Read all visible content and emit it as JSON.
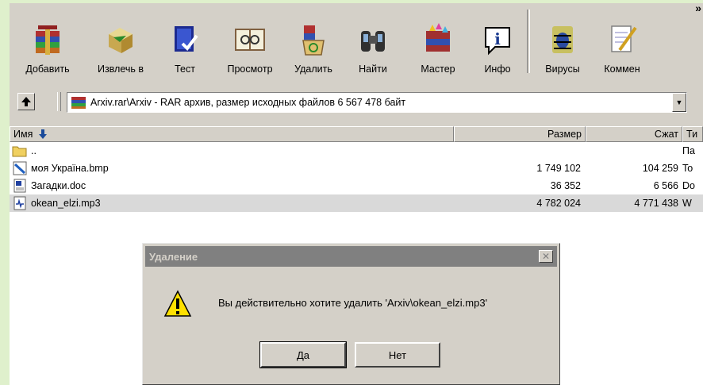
{
  "toolbar": {
    "buttons": [
      {
        "label": "Добавить",
        "icon": "add-archive-icon"
      },
      {
        "label": "Извлечь в",
        "icon": "extract-icon"
      },
      {
        "label": "Тест",
        "icon": "test-icon"
      },
      {
        "label": "Просмотр",
        "icon": "view-icon"
      },
      {
        "label": "Удалить",
        "icon": "delete-icon"
      },
      {
        "label": "Найти",
        "icon": "find-icon"
      },
      {
        "label": "Мастер",
        "icon": "wizard-icon"
      },
      {
        "label": "Инфо",
        "icon": "info-icon"
      },
      {
        "label": "Вирусы",
        "icon": "virus-scan-icon"
      },
      {
        "label": "Коммен",
        "icon": "comment-icon"
      }
    ],
    "overflow": "»"
  },
  "address": {
    "path": "Arxiv.rar\\Arxiv - RAR архив, размер исходных файлов 6 567 478 байт"
  },
  "list": {
    "headers": {
      "name": "Имя",
      "size": "Размер",
      "packed": "Сжат",
      "type": "Ти"
    },
    "rows": [
      {
        "name": "..",
        "size": "",
        "packed": "",
        "type": "Па",
        "icon": "folder-up-icon"
      },
      {
        "name": "моя Україна.bmp",
        "size": "1 749 102",
        "packed": "104 259",
        "type": "To",
        "icon": "bitmap-file-icon"
      },
      {
        "name": "Загадки.doc",
        "size": "36 352",
        "packed": "6 566",
        "type": "Do",
        "icon": "word-document-icon"
      },
      {
        "name": "okean_elzi.mp3",
        "size": "4 782 024",
        "packed": "4 771 438",
        "type": "W",
        "icon": "audio-file-icon"
      }
    ]
  },
  "dialog": {
    "title": "Удаление",
    "message": "Вы действительно хотите удалить 'Arxiv\\okean_elzi.mp3'",
    "yes": "Да",
    "no": "Нет"
  }
}
